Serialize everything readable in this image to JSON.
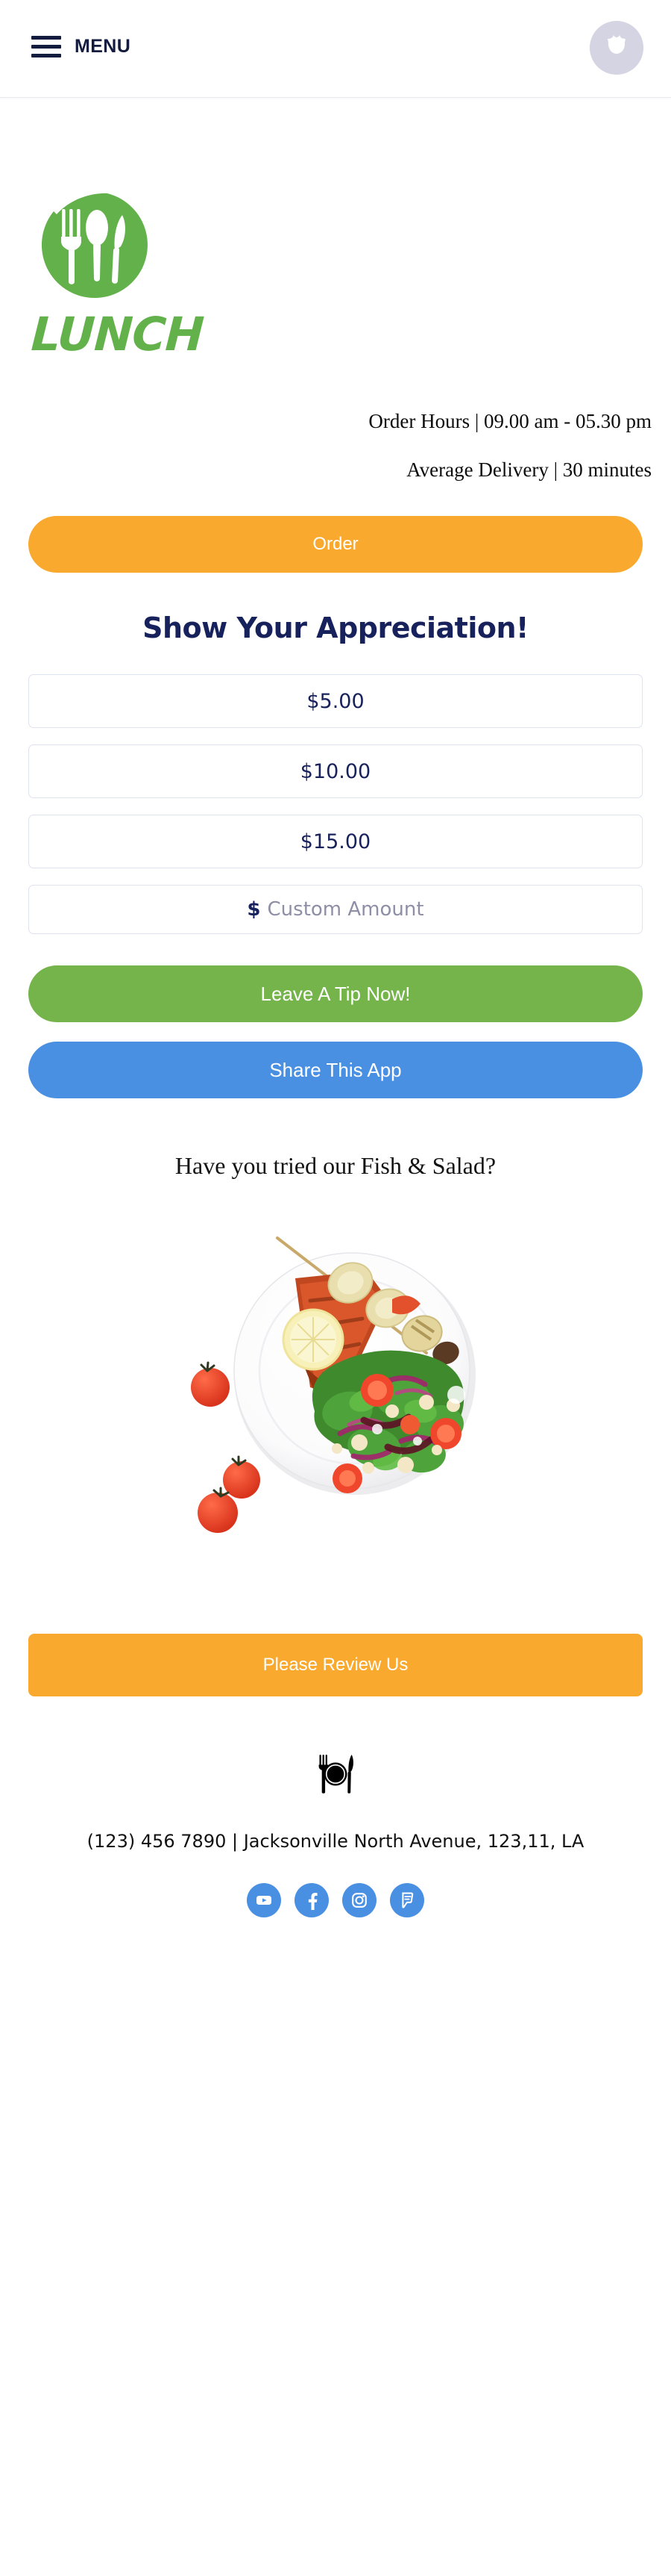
{
  "header": {
    "menu_label": "MENU",
    "menu_icon": "hamburger-icon",
    "avatar_icon": "user-avatar-placeholder"
  },
  "brand": {
    "logo_icon": "cutlery-circle-logo",
    "name": "LUNCH"
  },
  "info": {
    "order_hours": "Order Hours | 09.00 am - 05.30 pm",
    "average_delivery": "Average Delivery | 30 minutes"
  },
  "actions": {
    "order_label": "Order",
    "tip_label": "Leave A Tip Now!",
    "share_label": "Share This App",
    "review_label": "Please Review Us"
  },
  "tip_section": {
    "heading": "Show Your Appreciation!",
    "options": [
      {
        "label": "$5.00"
      },
      {
        "label": "$10.00"
      },
      {
        "label": "$15.00"
      }
    ],
    "custom": {
      "currency_sign": "$",
      "placeholder": "Custom Amount",
      "value": ""
    }
  },
  "promo": {
    "heading": "Have you tried our Fish & Salad?",
    "image_icon": "fish-and-salad-plate-photo"
  },
  "footer": {
    "icon": "plate-fork-knife-icon",
    "contact": "(123) 456 7890 | Jacksonville North Avenue, 123,11, LA",
    "socials": [
      {
        "name": "youtube-icon",
        "label": "YouTube"
      },
      {
        "name": "facebook-icon",
        "label": "Facebook"
      },
      {
        "name": "instagram-icon",
        "label": "Instagram"
      },
      {
        "name": "foursquare-icon",
        "label": "Foursquare"
      }
    ]
  },
  "colors": {
    "orange": "#f9a92e",
    "green": "#74b44a",
    "blue": "#4a90e2",
    "navy": "#17215c",
    "logo_green": "#62b14b",
    "border": "#dfe2ef",
    "placeholder": "#8e8fa6"
  }
}
